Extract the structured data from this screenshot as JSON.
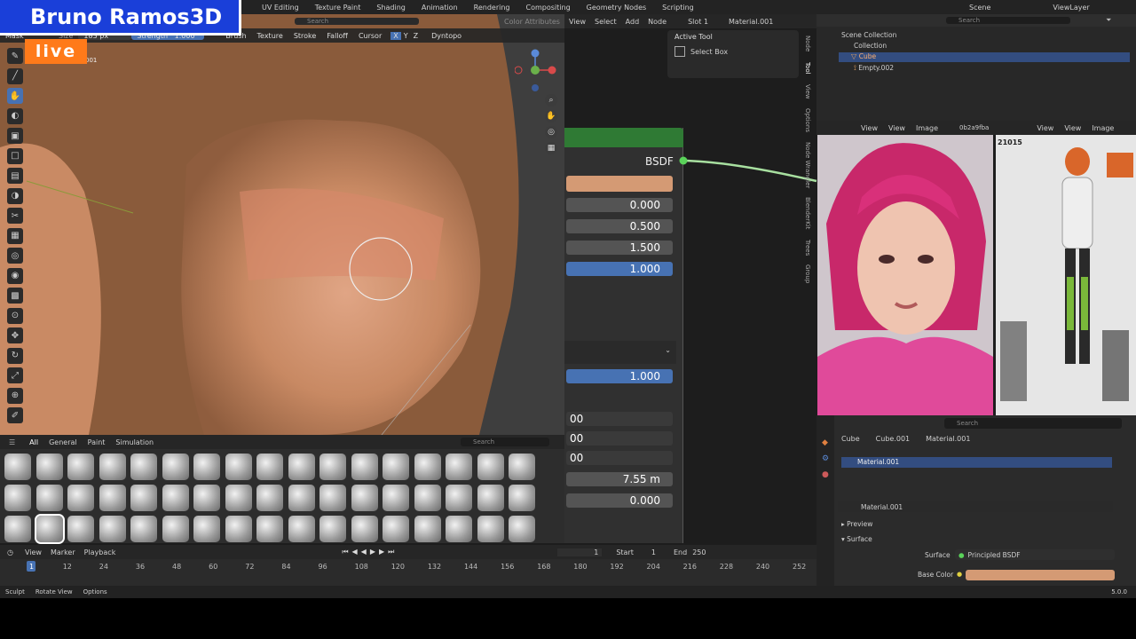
{
  "brand": {
    "name": "Bruno Ramos3D",
    "live": "live"
  },
  "workspaces": [
    "UV Editing",
    "Texture Paint",
    "Shading",
    "Animation",
    "Rendering",
    "Compositing",
    "Geometry Nodes",
    "Scripting"
  ],
  "viewport_header": {
    "mode": "Mask",
    "size_label": "Size",
    "size_value": "183 px",
    "strength_label": "Strength",
    "strength_value": "1.000",
    "menus": [
      "Brush",
      "Texture",
      "Stroke",
      "Falloff",
      "Cursor"
    ],
    "axes": [
      "X",
      "Y",
      "Z"
    ],
    "dyntopo": "Dyntopo",
    "object_label": "001",
    "search_placeholder": "Search",
    "color_attributes": "Color Attributes"
  },
  "node_editor": {
    "menu": [
      "View",
      "Select",
      "Add",
      "Node"
    ],
    "slot": "Slot 1",
    "material": "Material.001",
    "active_tool_title": "Active Tool",
    "active_tool_value": "Select Box",
    "node_title": "BSDF",
    "fields": [
      "0.000",
      "0.500",
      "1.500",
      "1.000"
    ],
    "field_lower": "1.000",
    "lower_vals": [
      "00",
      "00",
      "00"
    ],
    "distance": "7.55 m",
    "last_value": "0.000",
    "side_tabs": [
      "Node",
      "Tool",
      "View",
      "Options",
      "Node Wrangler",
      "BlenderKit",
      "Trees",
      "Group"
    ]
  },
  "outliner": {
    "scene": "Scene",
    "view_layer": "ViewLayer",
    "search_placeholder": "Search",
    "items": [
      {
        "label": "Scene Collection"
      },
      {
        "label": "Collection"
      },
      {
        "label": "Cube"
      },
      {
        "label": "Empty.002"
      }
    ]
  },
  "image_editor": {
    "menus": [
      "View",
      "View",
      "Image"
    ],
    "image_name": "0b2a9fba",
    "menus2": [
      "View",
      "View",
      "Image"
    ],
    "sheet_id": "21015"
  },
  "properties": {
    "search_placeholder": "Search",
    "breadcrumb": [
      "Cube",
      "Cube.001",
      "Material.001"
    ],
    "slot_item": "Material.001",
    "material_name": "Material.001",
    "sections": [
      "Preview",
      "Surface"
    ],
    "surface_label": "Surface",
    "surface_value": "Principled BSDF",
    "base_color_label": "Base Color",
    "base_color": "#d49a74"
  },
  "asset_browser": {
    "tabs": [
      "All",
      "General",
      "Paint",
      "Simulation"
    ],
    "search_placeholder": "Search"
  },
  "timeline": {
    "menus": [
      "View",
      "Marker",
      "Playback"
    ],
    "current_frame": "1",
    "start_label": "Start",
    "start": "1",
    "end_label": "End",
    "end": "250",
    "frames": [
      "1",
      "12",
      "24",
      "36",
      "48",
      "60",
      "72",
      "84",
      "96",
      "108",
      "120",
      "132",
      "144",
      "156",
      "168",
      "180",
      "192",
      "204",
      "216",
      "228",
      "240",
      "252"
    ]
  },
  "statusbar": {
    "items": [
      "Sculpt",
      "Rotate View",
      "Options"
    ],
    "version": "5.0.0"
  },
  "colors": {
    "accent": "#4772b3",
    "node_header": "#2f7a34",
    "logo_bg": "#1a3fd9",
    "live_bg": "#ff7a1a",
    "skin": "#d49a74"
  }
}
